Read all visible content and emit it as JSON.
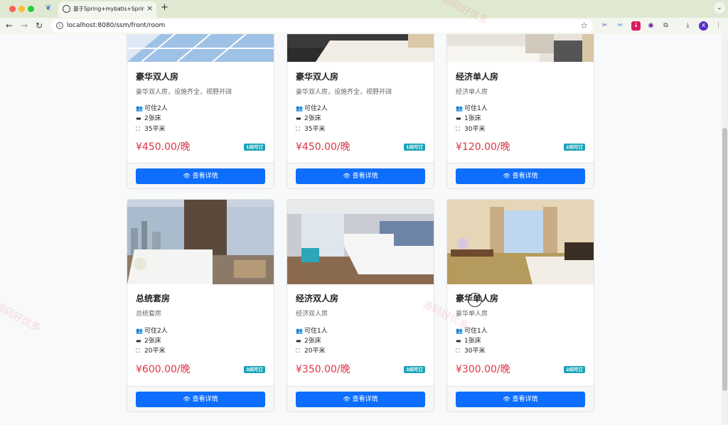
{
  "browser": {
    "tab_title": "基于Spring+mybatis+SpringMVC",
    "url": "localhost:8080/ssm/front/room",
    "profile_letter": "x"
  },
  "watermark": "源码好优多",
  "detail_label": "查看详情",
  "rooms": [
    {
      "name": "豪华双人房",
      "desc": "豪华双人房，设施齐全，视野开阔",
      "guests": "可住2人",
      "beds": "2张床",
      "area": "35平米",
      "price": "¥450.00/晚",
      "avail": "1间可订"
    },
    {
      "name": "豪华双人房",
      "desc": "豪华双人房，设施齐全，视野开阔",
      "guests": "可住2人",
      "beds": "2张床",
      "area": "35平米",
      "price": "¥450.00/晚",
      "avail": "1间可订"
    },
    {
      "name": "经济单人房",
      "desc": "经济单人房",
      "guests": "可住1人",
      "beds": "1张床",
      "area": "30平米",
      "price": "¥120.00/晚",
      "avail": "2间可订"
    },
    {
      "name": "总统套房",
      "desc": "总统套房",
      "guests": "可住2人",
      "beds": "2张床",
      "area": "20平米",
      "price": "¥600.00/晚",
      "avail": "3间可订"
    },
    {
      "name": "经济双人房",
      "desc": "经济双人房",
      "guests": "可住1人",
      "beds": "2张床",
      "area": "20平米",
      "price": "¥350.00/晚",
      "avail": "3间可订"
    },
    {
      "name": "豪华单人房",
      "desc": "豪华单人房",
      "guests": "可住1人",
      "beds": "1张床",
      "area": "30平米",
      "price": "¥300.00/晚",
      "avail": "2间可订"
    }
  ]
}
